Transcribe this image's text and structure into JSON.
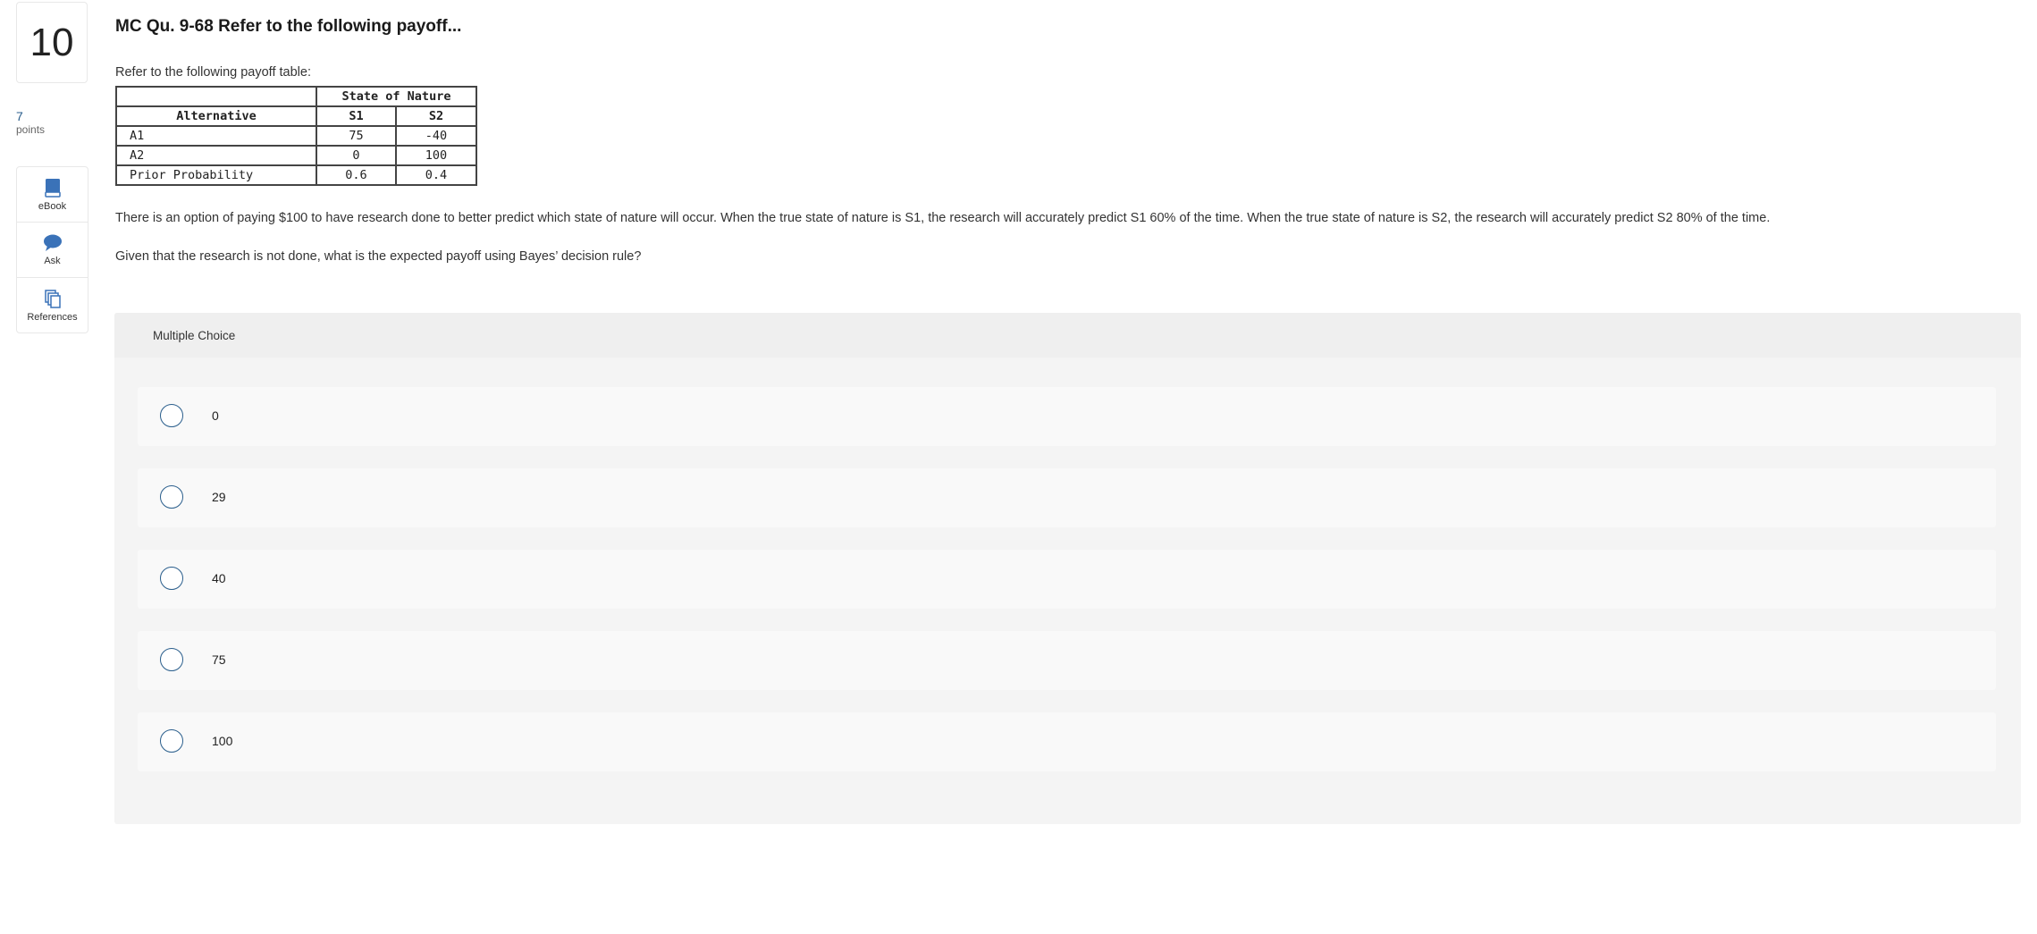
{
  "question": {
    "number": "10",
    "points_value": "7",
    "points_label": "points",
    "title": "MC Qu. 9-68 Refer to the following payoff...",
    "intro": "Refer to the following payoff table:",
    "paragraph1": "There is an option of paying $100 to have research done to better predict which state of nature will occur. When the true state of nature is S1, the research will accurately predict S1 60% of the time. When the true state of nature is S2, the research will accurately predict S2 80% of the time.",
    "paragraph2": "Given that the research is not done, what is the expected payoff using Bayes’ decision rule?"
  },
  "tools": [
    {
      "label": "eBook",
      "icon": "book-icon"
    },
    {
      "label": "Ask",
      "icon": "chat-bubble-icon"
    },
    {
      "label": "References",
      "icon": "copy-documents-icon"
    }
  ],
  "payoff_table": {
    "group_header": "State of Nature",
    "headers": [
      "Alternative",
      "S1",
      "S2"
    ],
    "rows": [
      [
        "A1",
        "75",
        "-40"
      ],
      [
        "A2",
        "0",
        "100"
      ],
      [
        "Prior Probability",
        "0.6",
        "0.4"
      ]
    ]
  },
  "multiple_choice": {
    "label": "Multiple Choice",
    "options": [
      "0",
      "29",
      "40",
      "75",
      "100"
    ],
    "selected": null
  },
  "colors": {
    "accent": "#2a5e8c",
    "icon_blue": "#3a72b8",
    "panel_bg": "#f4f4f4",
    "option_bg": "#f9f9f9"
  }
}
